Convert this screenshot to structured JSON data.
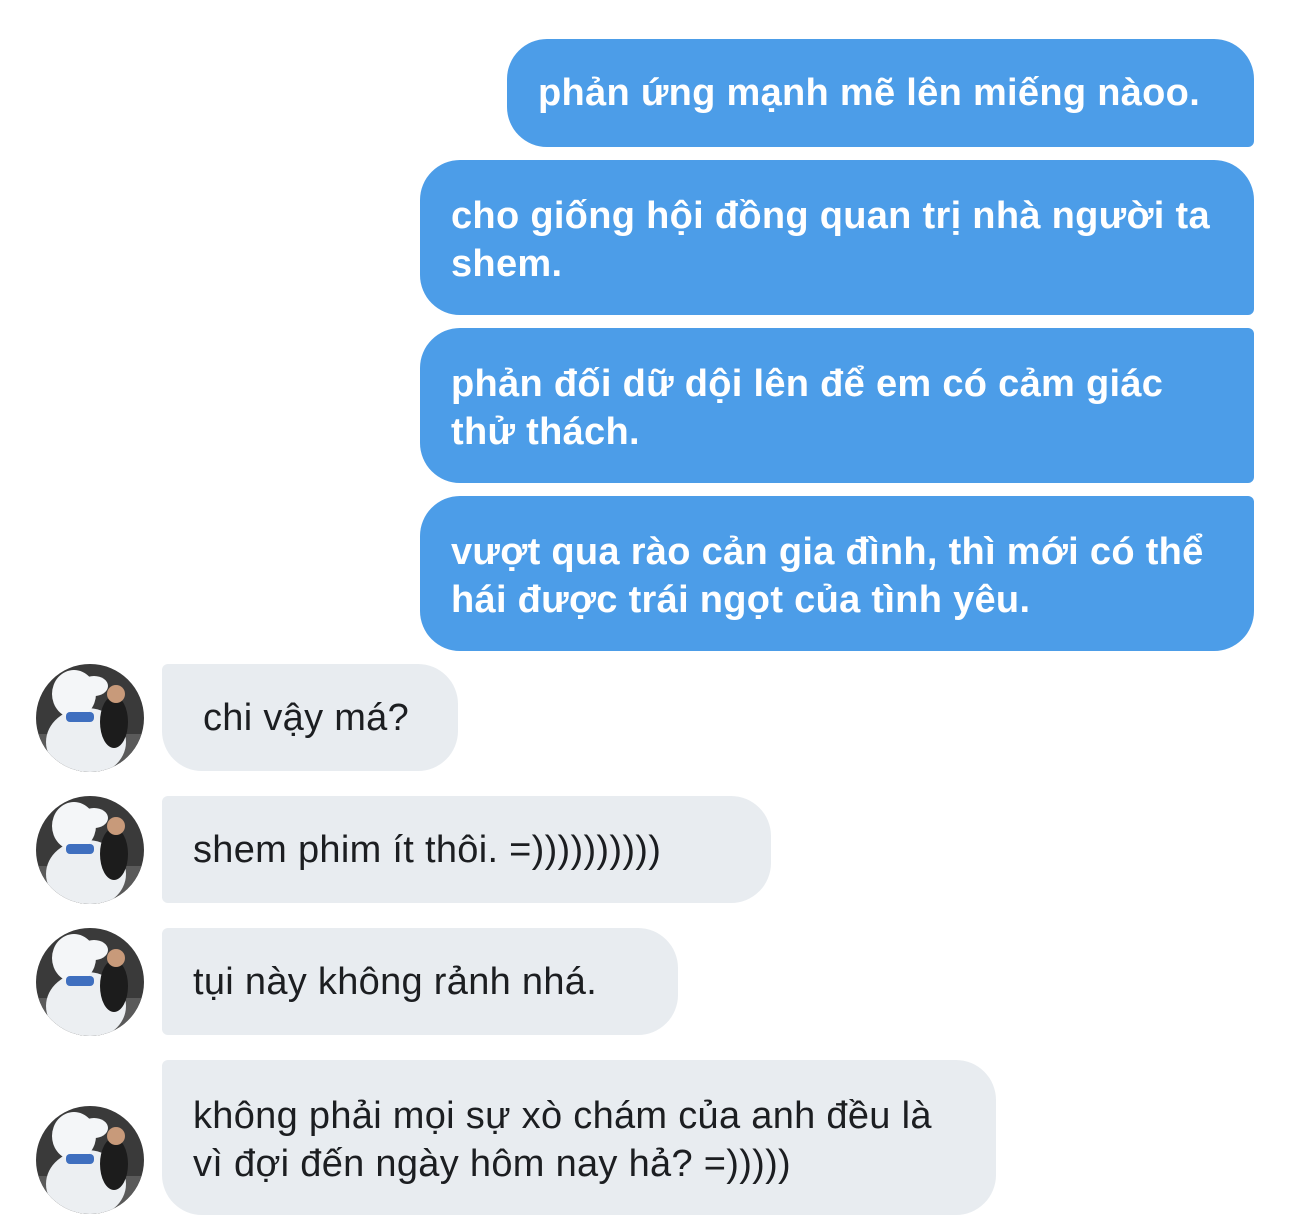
{
  "conversation": {
    "outgoing": [
      {
        "text": "phản ứng mạnh mẽ lên miếng nàoo."
      },
      {
        "text": "cho giống hội đồng quan trị nhà người ta shem."
      },
      {
        "text": "phản đối dữ dội lên để em có cảm giác thử thách."
      },
      {
        "text": "vượt qua rào cản gia đình, thì mới có thể hái được trái ngọt của tình yêu."
      }
    ],
    "incoming": [
      {
        "text": "chi vậy má?"
      },
      {
        "text": "shem phim ít thôi. =))))))))))"
      },
      {
        "text": "tụi này không rảnh nhá."
      },
      {
        "text": "không phải mọi sự xò chám của anh đều là vì đợi đến ngày hôm nay hả? =)))))"
      }
    ]
  },
  "colors": {
    "outgoing_bubble": "#4c9de8",
    "incoming_bubble": "#e8ecf0",
    "outgoing_text": "#ffffff",
    "incoming_text": "#1c1e21"
  },
  "icons": {
    "avatar": "contact-avatar-photo"
  }
}
